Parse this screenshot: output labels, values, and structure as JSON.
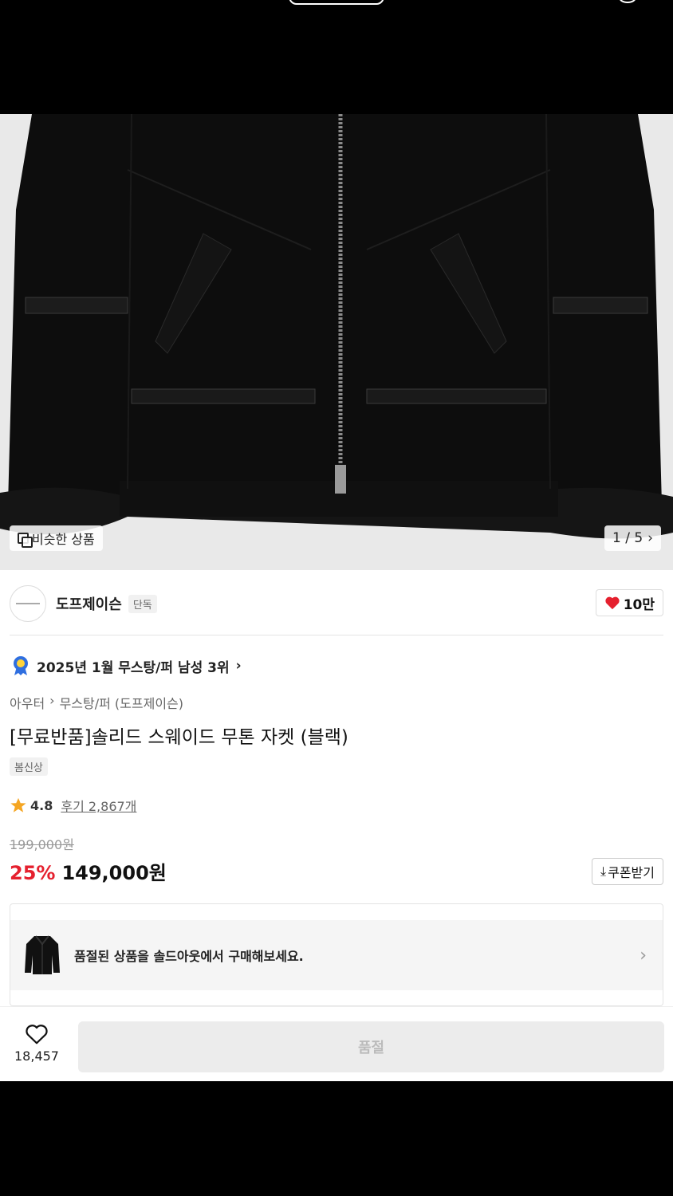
{
  "gallery": {
    "similar_label": "비슷한 상품",
    "pager": "1 / 5"
  },
  "brand": {
    "name": "도프제이슨",
    "tag": "단독",
    "likes": "10만"
  },
  "ranking": {
    "text": "2025년 1월 무스탕/퍼 남성 3위"
  },
  "breadcrumb": {
    "level1": "아우터",
    "level2": "무스탕/퍼 (도프제이슨)"
  },
  "product": {
    "title": "[무료반품]솔리드 스웨이드 무톤 자켓 (블랙)",
    "season_tag": "봄신상",
    "rating": "4.8",
    "review": "후기 2,867개",
    "original_price": "199,000원",
    "discount": "25%",
    "sale_price": "149,000원",
    "coupon_label": "쿠폰받기"
  },
  "soldout": {
    "text": "품절된 상품을 솔드아웃에서 구매해보세요."
  },
  "bottom": {
    "wish_count": "18,457",
    "buy_label": "품절"
  },
  "colors": {
    "accent_red": "#e5202e",
    "heart": "#e5202e",
    "star": "#f5a623",
    "rank_badge": "#2f6fe0"
  }
}
